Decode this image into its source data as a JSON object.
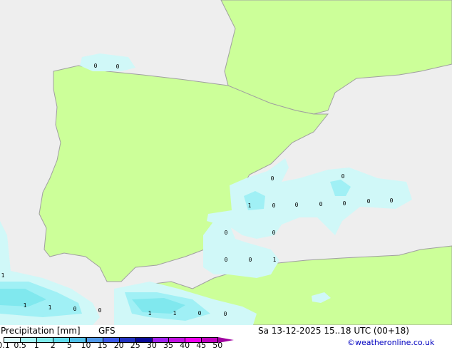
{
  "map": {
    "colors": {
      "sea": "#eeeeee",
      "land": "#ccff99",
      "border": "#a0a0a0",
      "precip_light": "#d0f8f8",
      "precip_1": "#a0f0f5",
      "precip_2": "#80e8ee"
    },
    "value_labels": [
      {
        "text": "0",
        "lon_lat": "Bay of Biscay"
      },
      {
        "text": "0"
      },
      {
        "text": "0"
      },
      {
        "text": "1"
      },
      {
        "text": "0"
      },
      {
        "text": "0"
      },
      {
        "text": "0"
      },
      {
        "text": "0"
      },
      {
        "text": "0"
      },
      {
        "text": "0"
      },
      {
        "text": "0"
      },
      {
        "text": "0"
      },
      {
        "text": "0"
      },
      {
        "text": "0"
      },
      {
        "text": "0"
      },
      {
        "text": "1"
      },
      {
        "text": "1"
      },
      {
        "text": "1"
      },
      {
        "text": "0"
      },
      {
        "text": "0"
      },
      {
        "text": "1"
      },
      {
        "text": "1"
      },
      {
        "text": "1"
      },
      {
        "text": "0"
      },
      {
        "text": "0"
      }
    ]
  },
  "legend": {
    "title": "Precipitation [mm]",
    "model": "GFS",
    "datetime": "Sa 13-12-2025 15..18 UTC (00+18)",
    "credit": "©weatheronline.co.uk",
    "ticks": [
      "0.1",
      "0.5",
      "1",
      "2",
      "5",
      "10",
      "15",
      "20",
      "25",
      "30",
      "35",
      "40",
      "45",
      "50"
    ],
    "colors": [
      "#d4fafa",
      "#a0f5f5",
      "#80ecec",
      "#60dcec",
      "#50c0e8",
      "#5098e8",
      "#3c5ae8",
      "#2232c0",
      "#0a0a96",
      "#a020f0",
      "#c010e0",
      "#f000f0",
      "#c000c0"
    ],
    "arrow_color": "#a000a0"
  }
}
